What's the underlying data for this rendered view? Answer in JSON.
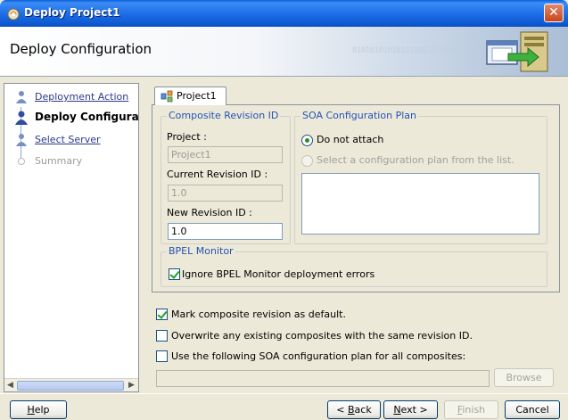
{
  "window": {
    "title": "Deploy Project1",
    "close_glyph": "✕"
  },
  "header": {
    "page_title": "Deploy Configuration",
    "binary_text": "01010101010101010101010"
  },
  "steps": [
    {
      "label": "Deployment Action",
      "state": "visited"
    },
    {
      "label": "Deploy Configuration",
      "state": "current"
    },
    {
      "label": "Select Server",
      "state": "visited"
    },
    {
      "label": "Summary",
      "state": "disabled"
    }
  ],
  "tab": {
    "label": "Project1"
  },
  "composite_revision": {
    "legend": "Composite Revision ID",
    "project_label": "Project :",
    "project_value": "Project1",
    "current_revision_label": "Current Revision ID :",
    "current_revision_value": "1.0",
    "new_revision_label": "New Revision ID :",
    "new_revision_value": "1.0"
  },
  "soa_plan": {
    "legend": "SOA Configuration Plan",
    "option_do_not_attach": "Do not attach",
    "option_select_plan": "Select a configuration plan from the list.",
    "selected": "Do not attach"
  },
  "bpel_monitor": {
    "legend": "BPEL Monitor",
    "ignore_errors_label": "Ignore BPEL Monitor deployment errors",
    "ignore_errors_checked": true
  },
  "options": {
    "mark_default_label": "Mark composite revision as default.",
    "mark_default_checked": true,
    "overwrite_label": "Overwrite any existing composites with the same revision ID.",
    "overwrite_checked": false,
    "use_plan_label": "Use the following SOA configuration plan for all composites:",
    "use_plan_checked": false,
    "plan_path_value": ""
  },
  "buttons": {
    "browse": "Browse",
    "help_pre": "",
    "help_key": "H",
    "help_post": "elp",
    "back_pre": "< ",
    "back_key": "B",
    "back_post": "ack",
    "next_pre": "",
    "next_key": "N",
    "next_post": "ext >",
    "finish_pre": "",
    "finish_key": "F",
    "finish_post": "inish",
    "cancel": "Cancel"
  },
  "colors": {
    "title_bar": "#1f6fe8",
    "legend": "#2552b8",
    "link": "#2a3a8c",
    "check": "#21a121"
  },
  "icons": {
    "app": "oracle-jdeveloper-icon",
    "tab": "composite-project-icon",
    "banner": "deploy-server-icon",
    "step_visited": "person-step-icon",
    "step_current": "person-step-current-icon",
    "step_disabled": "empty-step-icon"
  }
}
